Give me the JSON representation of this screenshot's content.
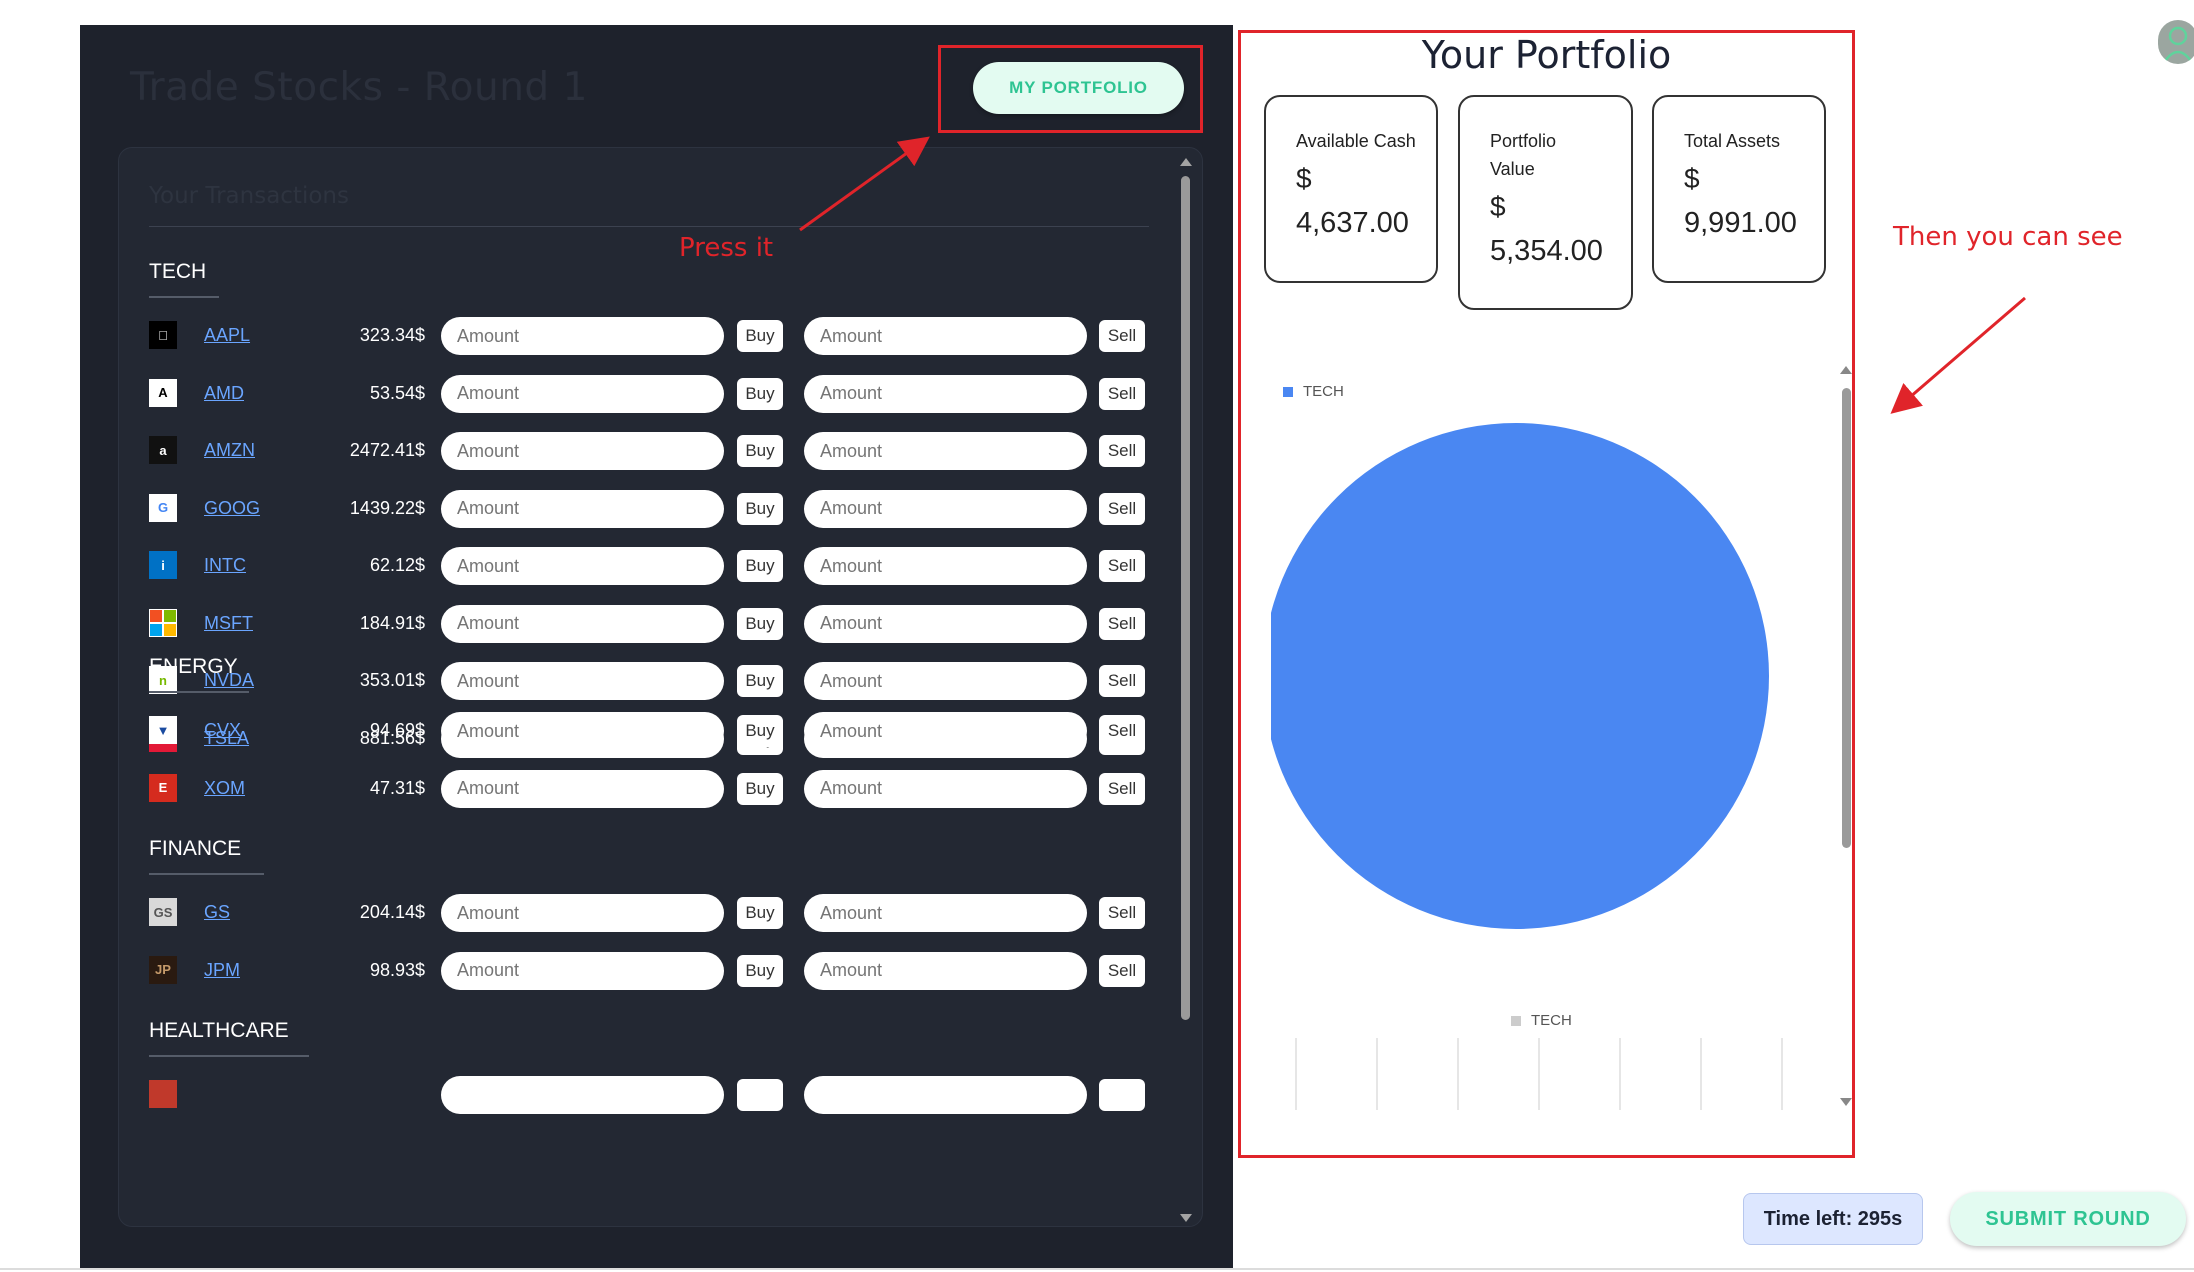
{
  "page": {
    "title": "Trade Stocks - Round 1",
    "my_portfolio_label": "MY PORTFOLIO",
    "transactions_title": "Your Transactions",
    "amount_placeholder": "Amount",
    "buy_label": "Buy",
    "sell_label": "Sell"
  },
  "annotations": {
    "press_it": "Press it",
    "then_see": "Then you can see"
  },
  "sections": [
    {
      "name": "TECH",
      "stocks": [
        {
          "ticker": "AAPL",
          "price": "323.34$",
          "logo": "apple-icon"
        },
        {
          "ticker": "AMD",
          "price": "53.54$",
          "logo": "amd-icon"
        },
        {
          "ticker": "AMZN",
          "price": "2472.41$",
          "logo": "amazon-icon"
        },
        {
          "ticker": "GOOG",
          "price": "1439.22$",
          "logo": "google-icon"
        },
        {
          "ticker": "INTC",
          "price": "62.12$",
          "logo": "intel-icon"
        },
        {
          "ticker": "MSFT",
          "price": "184.91$",
          "logo": "microsoft-icon"
        },
        {
          "ticker": "NVDA",
          "price": "353.01$",
          "logo": "nvidia-icon"
        },
        {
          "ticker": "TSLA",
          "price": "881.56$",
          "logo": "tesla-icon"
        }
      ]
    },
    {
      "name": "ENERGY",
      "stocks": [
        {
          "ticker": "CVX",
          "price": "94.69$",
          "logo": "chevron-icon"
        },
        {
          "ticker": "XOM",
          "price": "47.31$",
          "logo": "exxon-icon"
        }
      ]
    },
    {
      "name": "FINANCE",
      "stocks": [
        {
          "ticker": "GS",
          "price": "204.14$",
          "logo": "goldman-icon"
        },
        {
          "ticker": "JPM",
          "price": "98.93$",
          "logo": "jpmorgan-icon"
        }
      ]
    },
    {
      "name": "HEALTHCARE",
      "stocks": []
    }
  ],
  "portfolio": {
    "title": "Your Portfolio",
    "cards": [
      {
        "label": "Available Cash",
        "currency": "$",
        "value": "4,637.00"
      },
      {
        "label": "Portfolio Value",
        "currency": "$",
        "value": "5,354.00"
      },
      {
        "label": "Total Assets",
        "currency": "$",
        "value": "9,991.00"
      }
    ]
  },
  "chart_data": {
    "type": "pie",
    "categories": [
      "TECH"
    ],
    "values": [
      100
    ],
    "colors": [
      "#4a87f2"
    ],
    "legend": [
      "TECH"
    ],
    "legend_position": "top-left"
  },
  "footer": {
    "time_left": "Time left: 295s",
    "submit_label": "SUBMIT ROUND"
  },
  "colors": {
    "dark_bg": "#1e222c",
    "accent_green": "#2ec492",
    "annotation_red": "#e0242a",
    "link_blue": "#6aa5ff",
    "pie_blue": "#4a87f2"
  }
}
